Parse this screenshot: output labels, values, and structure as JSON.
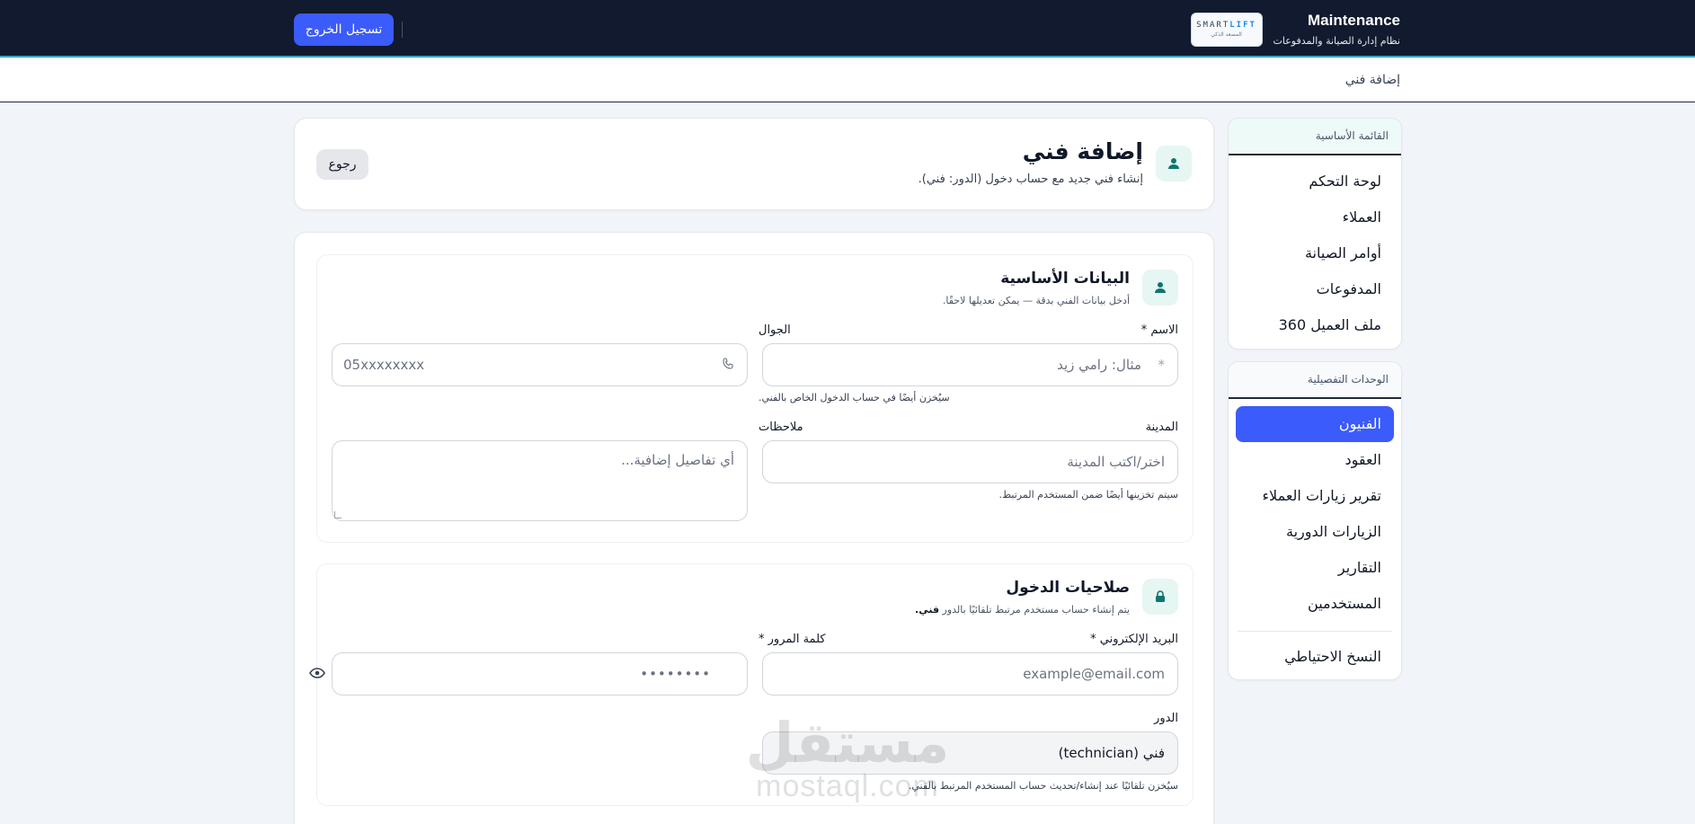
{
  "header": {
    "brand_title": "Maintenance",
    "brand_subtitle": "نظام إدارة الصيانة والمدفوعات",
    "logo_text": "SMARTLIFT",
    "logo_subtext": "المصعد الذكي",
    "logout_label": "تسجيل الخروج"
  },
  "breadcrumb": "إضافة فني",
  "sidebar": {
    "main_title": "القائمة الأساسية",
    "main_items": [
      "لوحة التحكم",
      "العملاء",
      "أوامر الصيانة",
      "المدفوعات",
      "ملف العميل 360"
    ],
    "detail_title": "الوحدات التفصيلية",
    "detail_items": [
      "الفنيون",
      "العقود",
      "تقرير زيارات العملاء",
      "الزيارات الدورية",
      "التقارير",
      "المستخدمين"
    ],
    "active_item": "الفنيون",
    "footer_item": "النسخ الاحتياطي"
  },
  "page": {
    "title": "إضافة فني",
    "subtitle": "إنشاء فني جديد مع حساب دخول (الدور: فني).",
    "back_label": "رجوع"
  },
  "basic": {
    "title": "البيانات الأساسية",
    "subtitle": "أدخل بيانات الفني بدقة — يمكن تعديلها لاحقًا.",
    "name_label": "الاسم *",
    "name_placeholder": "مثال: رامي زيد",
    "name_marker": "*",
    "phone_label": "الجوال",
    "phone_placeholder": "05xxxxxxxx",
    "phone_hint": "سيُخزن أيضًا في حساب الدخول الخاص بالفني.",
    "city_label": "المدينة",
    "city_placeholder": "اختر/اكتب المدينة",
    "city_hint": "سيتم تخزينها أيضًا ضمن المستخدم المرتبط.",
    "notes_label": "ملاحظات",
    "notes_placeholder": "أي تفاصيل إضافية..."
  },
  "access": {
    "title": "صلاحيات الدخول",
    "subtitle_prefix": "يتم إنشاء حساب مستخدم مرتبط تلقائيًا بالدور",
    "subtitle_role": "فني.",
    "email_label": "البريد الإلكتروني *",
    "email_placeholder": "example@email.com",
    "password_label": "كلمة المرور *",
    "password_placeholder": "••••••••",
    "role_label": "الدور",
    "role_value": "فني (technician)",
    "role_hint": "سيُخزن تلقائيًا عند إنشاء/تحديث حساب المستخدم المرتبط بالفني."
  },
  "watermark": {
    "arabic": "مستقل",
    "latin": "mostaql.com"
  },
  "colors": {
    "primary": "#3b5bfb",
    "topbar": "#111a2e",
    "accent": "#3aa0c8",
    "icon_bg": "#e6f6f3",
    "icon": "#0f766e"
  }
}
